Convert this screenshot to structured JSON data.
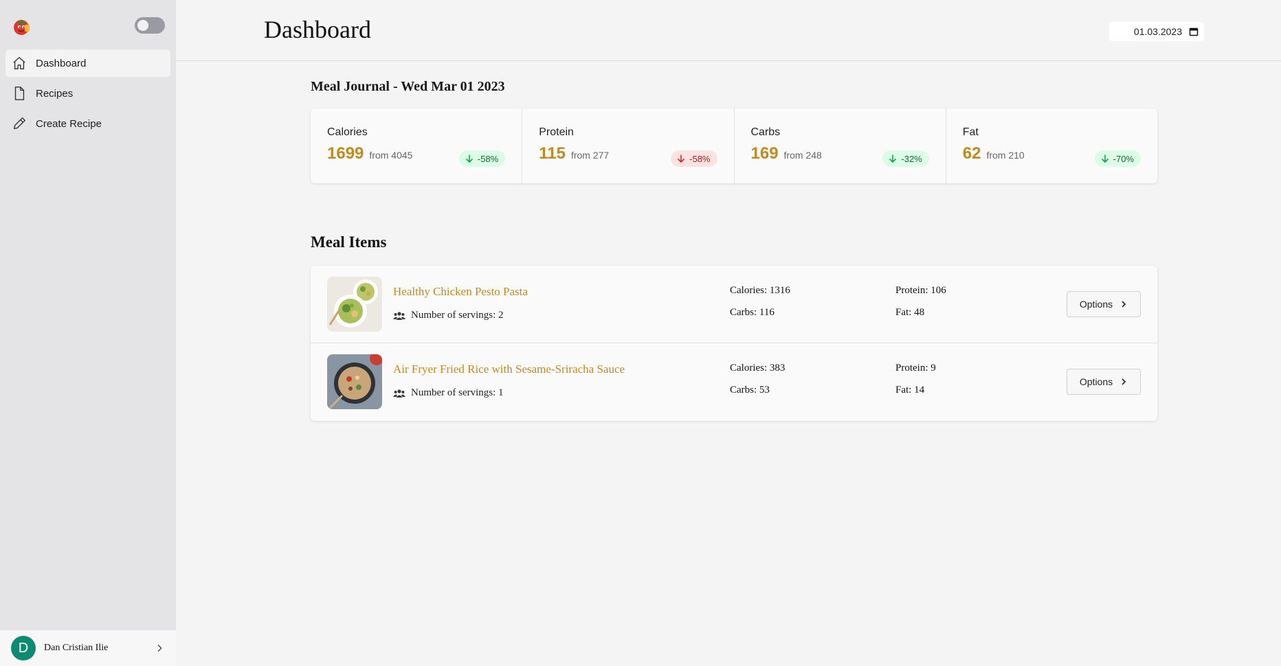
{
  "sidebar": {
    "logo_icon": "tomato-mascot-logo",
    "theme_toggle_on": false,
    "items": [
      {
        "label": "Dashboard",
        "icon": "home-icon",
        "active": true
      },
      {
        "label": "Recipes",
        "icon": "document-icon",
        "active": false
      },
      {
        "label": "Create Recipe",
        "icon": "pencil-icon",
        "active": false
      }
    ],
    "user": {
      "initial": "D",
      "name": "Dan Cristian Ilie",
      "avatar_color": "#0f8a72"
    }
  },
  "header": {
    "title": "Dashboard",
    "date_value": "01.03.2023"
  },
  "journal": {
    "title": "Meal Journal - Wed Mar 01 2023",
    "stats": [
      {
        "label": "Calories",
        "value": "1699",
        "from": "from 4045",
        "change": "-58%",
        "trend": "good"
      },
      {
        "label": "Protein",
        "value": "115",
        "from": "from 277",
        "change": "-58%",
        "trend": "bad"
      },
      {
        "label": "Carbs",
        "value": "169",
        "from": "from 248",
        "change": "-32%",
        "trend": "good"
      },
      {
        "label": "Fat",
        "value": "62",
        "from": "from 210",
        "change": "-70%",
        "trend": "good"
      }
    ]
  },
  "meal_items": {
    "title": "Meal Items",
    "options_label": "Options",
    "items": [
      {
        "name": "Healthy Chicken Pesto Pasta",
        "servings": "Number of servings: 2",
        "calories": "Calories: 1316",
        "protein": "Protein: 106",
        "carbs": "Carbs: 116",
        "fat": "Fat: 48"
      },
      {
        "name": "Air Fryer Fried Rice with Sesame-Sriracha Sauce",
        "servings": "Number of servings: 1",
        "calories": "Calories: 383",
        "protein": "Protein: 9",
        "carbs": "Carbs: 53",
        "fat": "Fat: 14"
      }
    ]
  },
  "colors": {
    "accent": "#c08a1e",
    "good_badge_bg": "#dcfce7",
    "bad_badge_bg": "#fde2e2",
    "sidebar_bg": "#e4e4e7"
  }
}
